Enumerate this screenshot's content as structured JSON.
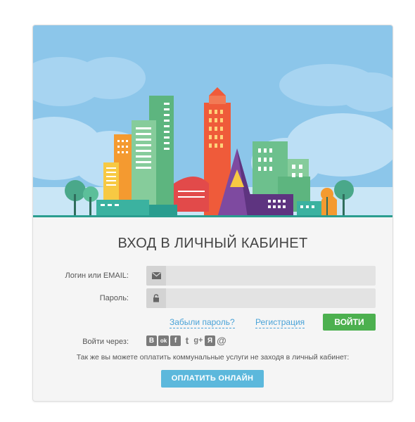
{
  "form": {
    "title": "ВХОД В ЛИЧНЫЙ КАБИНЕТ",
    "login_label": "Логин или EMAIL:",
    "login_value": "",
    "password_label": "Пароль:",
    "password_value": "",
    "forgot_link": "Забыли пароль?",
    "register_link": "Регистрация",
    "login_button": "ВОЙТИ"
  },
  "social": {
    "label": "Войти через:",
    "icons": [
      {
        "name": "vk-icon",
        "glyph": "B"
      },
      {
        "name": "odnoklassniki-icon",
        "glyph": "ok"
      },
      {
        "name": "facebook-icon",
        "glyph": "f"
      },
      {
        "name": "twitter-icon",
        "glyph": "t"
      },
      {
        "name": "google-plus-icon",
        "glyph": "g+"
      },
      {
        "name": "yandex-icon",
        "glyph": "Я"
      },
      {
        "name": "mailru-icon",
        "glyph": "@"
      }
    ]
  },
  "payment": {
    "note": "Так же вы можете оплатить коммунальные услуги не заходя в личный кабинет:",
    "button": "ОПЛАТИТЬ ОНЛАЙН"
  },
  "colors": {
    "accent_green": "#4cb04f",
    "accent_blue": "#5cb8dc",
    "link_blue": "#4aa3d8",
    "sky": "#8cc6ea"
  }
}
